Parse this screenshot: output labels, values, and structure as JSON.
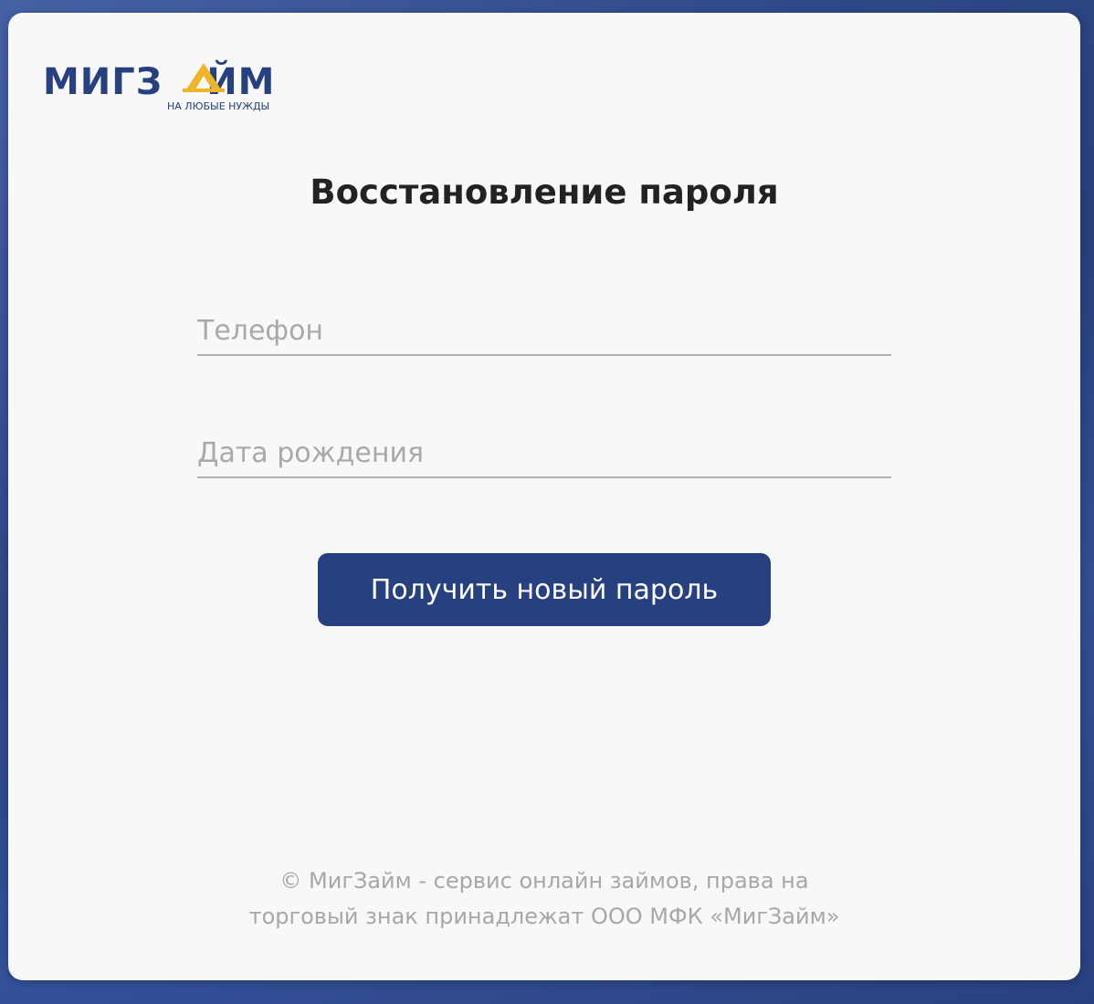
{
  "logo": {
    "text_left": "МИГЗ",
    "text_right": "ЙМ",
    "tagline": "НА ЛЮБЫЕ НУЖДЫ",
    "brand_color": "#27407f",
    "accent_color": "#f0b429"
  },
  "page": {
    "title": "Восстановление пароля"
  },
  "form": {
    "phone_placeholder": "Телефон",
    "dob_placeholder": "Дата рождения",
    "submit_label": "Получить новый пароль"
  },
  "footer": {
    "line1": "© МигЗайм - сервис онлайн займов, права на",
    "line2": "торговый знак принадлежат ООО МФК «МигЗайм»"
  },
  "colors": {
    "background": "#2f4a8c",
    "card": "#f8f8f8",
    "button": "#27407f",
    "placeholder": "#a9a9a9",
    "footer_text": "#a7a7a7"
  }
}
